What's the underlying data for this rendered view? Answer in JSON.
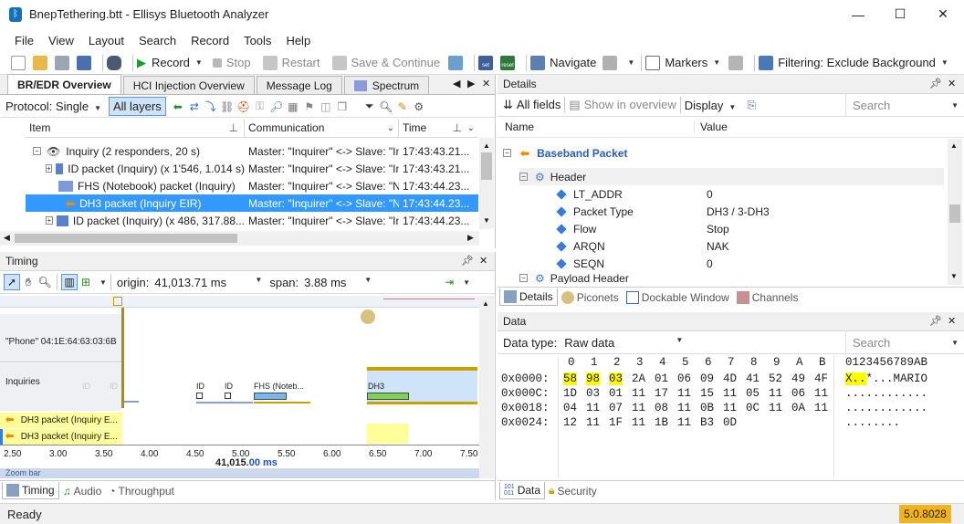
{
  "window": {
    "title": "BnepTethering.btt - Ellisys Bluetooth Analyzer",
    "minimize": "—",
    "maximize": "☐",
    "close": "✕"
  },
  "menu": [
    "File",
    "View",
    "Layout",
    "Search",
    "Record",
    "Tools",
    "Help"
  ],
  "toolbar": {
    "record": "Record",
    "stop": "Stop",
    "restart": "Restart",
    "save_continue": "Save & Continue",
    "navigate": "Navigate",
    "markers": "Markers",
    "filtering": "Filtering: Exclude Background",
    "icon_labels": {
      "set": "set",
      "reset": "reset"
    }
  },
  "overview": {
    "tabs": [
      "BR/EDR Overview",
      "HCI Injection Overview",
      "Message Log",
      "Spectrum"
    ],
    "protocol": "Protocol: Single",
    "all_layers": "All layers",
    "columns": {
      "item": "Item",
      "communication": "Communication",
      "time": "Time"
    },
    "rows": [
      {
        "item": "Inquiry (2 responders, 20 s)",
        "comm": "Master: \"Inquirer\" <-> Slave: \"Inc",
        "time": "17:43:43.21..."
      },
      {
        "item": "ID packet (Inquiry) (x 1'546, 1.014 s)",
        "comm": "Master: \"Inquirer\" <-> Slave: \"Inc",
        "time": "17:43:43.21..."
      },
      {
        "item": "FHS (Notebook) packet (Inquiry)",
        "comm": "Master: \"Inquirer\" <-> Slave: \"No",
        "time": "17:43:44.23..."
      },
      {
        "item": "DH3 packet (Inquiry EIR)",
        "comm": "Master: \"Inquirer\" <-> Slave: \"No",
        "time": "17:43:44.23..."
      },
      {
        "item": "ID packet (Inquiry) (x 486, 317.88...",
        "comm": "Master: \"Inquirer\" <-> Slave: \"Inc",
        "time": "17:43:44.23..."
      }
    ]
  },
  "timing": {
    "title": "Timing",
    "origin_label": "origin:",
    "origin_value": "41,013.71 ms",
    "span_label": "span:",
    "span_value": "3.88 ms",
    "lanes": {
      "phone": "\"Phone\" 04:1E:64:63:03:6B",
      "inquiries": "Inquiries",
      "pkt1": "DH3 packet (Inquiry E...",
      "pkt2": "DH3 packet (Inquiry E..."
    },
    "blocks": {
      "id1": "ID",
      "id2": "ID",
      "fhs": "FHS (Noteb...",
      "dh3": "DH3",
      "faint1": "ID",
      "faint2": "ID"
    },
    "axis_ticks": [
      "2.50",
      "3.00",
      "3.50",
      "4.00",
      "4.50",
      "5.00",
      "5.50",
      "6.00",
      "6.50",
      "7.00",
      "7.50"
    ],
    "axis_center_prefix": "41,015",
    "axis_center_suffix": ".00  ms",
    "zoom_label": "Zoom bar",
    "tabs": [
      "Timing",
      "Audio",
      "Throughput"
    ]
  },
  "details": {
    "title": "Details",
    "all_fields": "All fields",
    "show_overview": "Show in overview",
    "display": "Display",
    "search_ph": "Search",
    "columns": {
      "name": "Name",
      "value": "Value"
    },
    "packet": "Baseband Packet",
    "header": "Header",
    "fields": [
      {
        "name": "LT_ADDR",
        "value": "0"
      },
      {
        "name": "Packet Type",
        "value": "DH3 / 3-DH3"
      },
      {
        "name": "Flow",
        "value": "Stop"
      },
      {
        "name": "ARQN",
        "value": "NAK"
      },
      {
        "name": "SEQN",
        "value": "0"
      }
    ],
    "payload": "Payload Header",
    "tabs": [
      "Details",
      "Piconets",
      "Dockable Window",
      "Channels"
    ]
  },
  "data": {
    "title": "Data",
    "type_label": "Data type:",
    "type_value": "Raw data",
    "search_ph": "Search",
    "hex_header": [
      "0",
      "1",
      "2",
      "3",
      "4",
      "5",
      "6",
      "7",
      "8",
      "9",
      "A",
      "B"
    ],
    "ascii_header": "0123456789AB",
    "rows": [
      {
        "offset": "0x0000:",
        "bytes": [
          "58",
          "98",
          "03",
          "2A",
          "01",
          "06",
          "09",
          "4D",
          "41",
          "52",
          "49",
          "4F"
        ],
        "ascii_hl": "X..",
        "ascii_rest": "*...MARIO"
      },
      {
        "offset": "0x000C:",
        "bytes": [
          "1D",
          "03",
          "01",
          "11",
          "17",
          "11",
          "15",
          "11",
          "05",
          "11",
          "06",
          "11"
        ],
        "ascii_hl": "",
        "ascii_rest": "............"
      },
      {
        "offset": "0x0018:",
        "bytes": [
          "04",
          "11",
          "07",
          "11",
          "08",
          "11",
          "0B",
          "11",
          "0C",
          "11",
          "0A",
          "11"
        ],
        "ascii_hl": "",
        "ascii_rest": "............"
      },
      {
        "offset": "0x0024:",
        "bytes": [
          "12",
          "11",
          "1F",
          "11",
          "1B",
          "11",
          "B3",
          "0D"
        ],
        "ascii_hl": "",
        "ascii_rest": "........"
      }
    ],
    "tabs": [
      "Data",
      "Security"
    ]
  },
  "status": {
    "text": "Ready",
    "version": "5.0.8028"
  },
  "colors": {
    "accent": "#3399ff",
    "selected": "#3399ff",
    "highlight": "#ffff00",
    "version_bg": "#f2b31b",
    "packet_orange": "#f08a00"
  }
}
